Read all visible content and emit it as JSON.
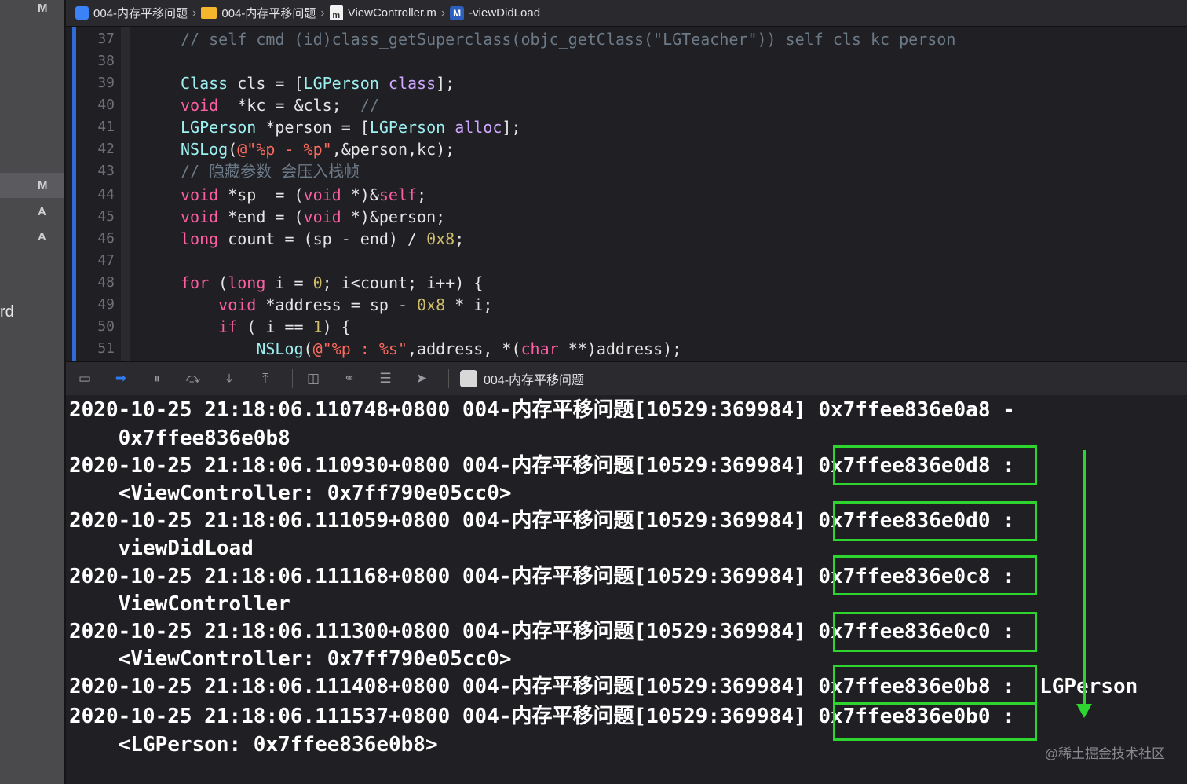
{
  "navigator": {
    "top_letter": "M",
    "letters": [
      "M",
      "A",
      "A"
    ],
    "clipped_text": "rd"
  },
  "breadcrumb": {
    "project": "004-内存平移问题",
    "folder": "004-内存平移问题",
    "file": "ViewController.m",
    "method": "-viewDidLoad",
    "file_icon": "m",
    "method_icon": "M"
  },
  "editor": {
    "lines": [
      {
        "num": "37"
      },
      {
        "num": "38"
      },
      {
        "num": "39"
      },
      {
        "num": "40"
      },
      {
        "num": "41"
      },
      {
        "num": "42"
      },
      {
        "num": "43"
      },
      {
        "num": "44"
      },
      {
        "num": "45"
      },
      {
        "num": "46"
      },
      {
        "num": "47"
      },
      {
        "num": "48"
      },
      {
        "num": "49"
      },
      {
        "num": "50"
      },
      {
        "num": "51"
      }
    ]
  },
  "debug_toolbar": {
    "process_label": "004-内存平移问题",
    "icons": [
      "hide-console-icon",
      "breakpoints-icon",
      "pause-icon",
      "step-over-icon",
      "step-into-icon",
      "step-out-icon",
      "view-debugger-icon",
      "memory-graph-icon",
      "environment-icon",
      "location-icon"
    ]
  },
  "console": {
    "lines": [
      {
        "t": "2020-10-25 21:18:06.110748+0800 004-内存平移问题[10529:369984] 0x7ffee836e0a8 -"
      },
      {
        "t": "    0x7ffee836e0b8"
      },
      {
        "t": "2020-10-25 21:18:06.110930+0800 004-内存平移问题[10529:369984] 0x7ffee836e0d8 :"
      },
      {
        "t": "    <ViewController: 0x7ff790e05cc0>"
      },
      {
        "t": "2020-10-25 21:18:06.111059+0800 004-内存平移问题[10529:369984] 0x7ffee836e0d0 :"
      },
      {
        "t": "    viewDidLoad"
      },
      {
        "t": "2020-10-25 21:18:06.111168+0800 004-内存平移问题[10529:369984] 0x7ffee836e0c8 :"
      },
      {
        "t": "    ViewController"
      },
      {
        "t": "2020-10-25 21:18:06.111300+0800 004-内存平移问题[10529:369984] 0x7ffee836e0c0 :"
      },
      {
        "t": "    <ViewController: 0x7ff790e05cc0>"
      },
      {
        "t": "2020-10-25 21:18:06.111408+0800 004-内存平移问题[10529:369984] 0x7ffee836e0b8 :  LGPerson"
      },
      {
        "t": "2020-10-25 21:18:06.111537+0800 004-内存平移问题[10529:369984] 0x7ffee836e0b0 :"
      },
      {
        "t": "    <LGPerson: 0x7ffee836e0b8>"
      }
    ]
  },
  "annotation": {
    "box_color": "#2fd52f",
    "arrow_color": "#2fd52f"
  },
  "watermark": "@稀土掘金技术社区"
}
